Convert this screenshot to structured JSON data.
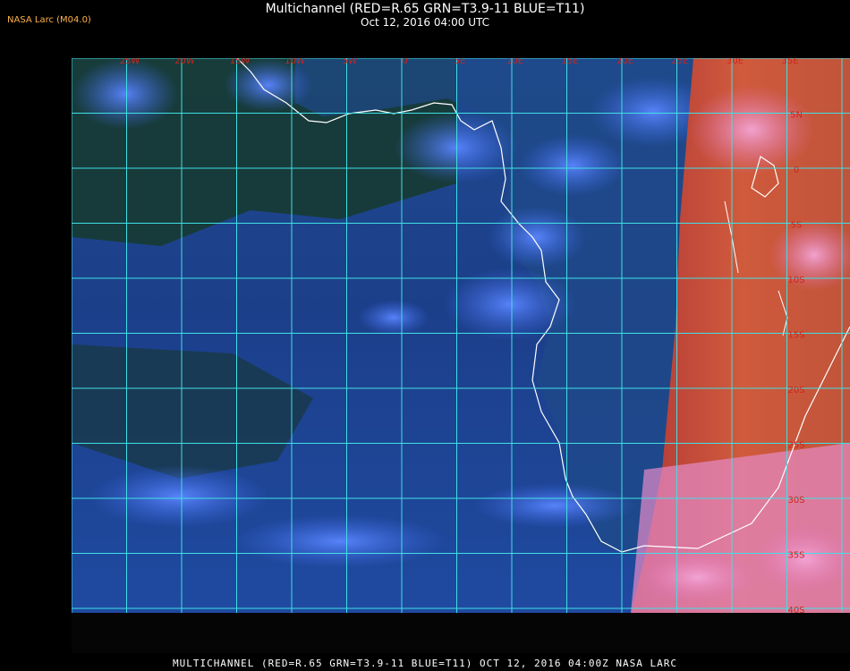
{
  "header": {
    "title": "Multichannel (RED=R.65 GRN=T3.9-11 BLUE=T11)",
    "subtitle": "Oct 12, 2016 04:00 UTC",
    "org": "NASA Larc (M04.0)"
  },
  "footer": {
    "caption": "MULTICHANNEL (RED=R.65 GRN=T3.9-11 BLUE=T11) OCT 12, 2016 04:00Z  NASA LARC"
  },
  "map": {
    "lon_labels": [
      "25W",
      "20W",
      "15W",
      "10W",
      "5W",
      "0",
      "5E",
      "10E",
      "15E",
      "20E",
      "25E",
      "30E",
      "35E"
    ],
    "lat_labels": [
      "5N",
      "0",
      "5S",
      "10S",
      "15S",
      "20S",
      "25S",
      "30S",
      "35S",
      "40S"
    ],
    "colors": {
      "grid": "#3fe0e6",
      "coastline": "#ffffff",
      "labels": "#d0241c",
      "ocean": "#1d3f86",
      "cloud": "#3b66e0",
      "land_day": "#c84a3a"
    }
  }
}
